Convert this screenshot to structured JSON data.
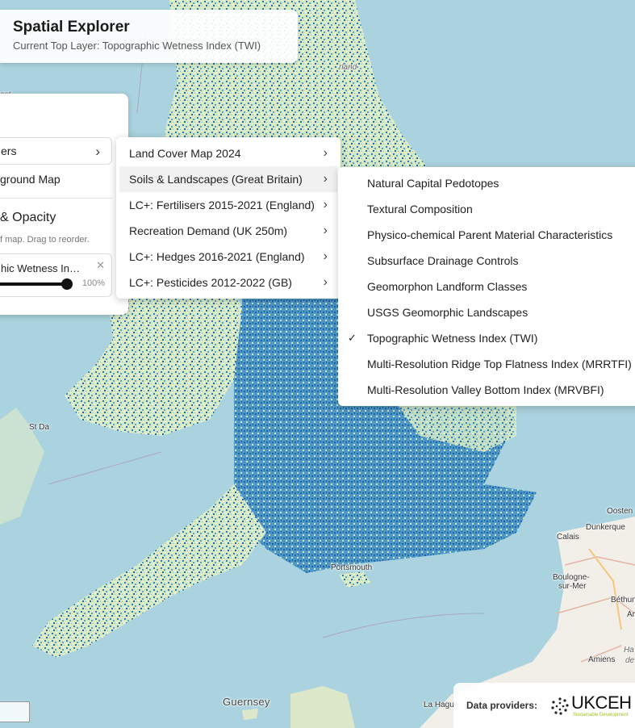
{
  "header": {
    "title": "Spatial Explorer",
    "subtitle": "Current Top Layer: Topographic Wetness Index (TWI)"
  },
  "panel": {
    "layers_label": "ers",
    "background_label": "ground Map",
    "opacity_title": "& Opacity",
    "opacity_hint": "f map. Drag to reorder.",
    "layer_name": "hic Wetness In…",
    "layer_opacity_value": 1.0,
    "layer_opacity_label": "100%"
  },
  "menu_categories": [
    {
      "label": "Land Cover Map 2024"
    },
    {
      "label": "Soils & Landscapes (Great Britain)"
    },
    {
      "label": "LC+: Fertilisers 2015-2021 (England)"
    },
    {
      "label": "Recreation Demand (UK 250m)"
    },
    {
      "label": "LC+: Hedges 2016-2021 (England)"
    },
    {
      "label": "LC+: Pesticides 2012-2022 (GB)"
    }
  ],
  "active_category": "Soils & Landscapes (Great Britain)",
  "menu_layers": [
    {
      "label": "Natural Capital Pedotopes",
      "checked": false
    },
    {
      "label": "Textural Composition",
      "checked": false
    },
    {
      "label": "Physico-chemical Parent Material Characteristics",
      "checked": false
    },
    {
      "label": "Subsurface Drainage Controls",
      "checked": false
    },
    {
      "label": "Geomorphon Landform Classes",
      "checked": false
    },
    {
      "label": "USGS Geomorphic Landscapes",
      "checked": false
    },
    {
      "label": "Topographic Wetness Index (TWI)",
      "checked": true
    },
    {
      "label": "Multi-Resolution Ridge Top Flatness Index (MRRTFI)",
      "checked": false
    },
    {
      "label": "Multi-Resolution Valley Bottom Index (MRVBFI)",
      "checked": false
    }
  ],
  "map_labels": {
    "rland": "rland",
    "stdavids": "St Da",
    "portsmouth": "Portsmouth",
    "guernsey": "Guernsey",
    "calais": "Calais",
    "dunkerque": "Dunkerque",
    "oostende": "Oosten",
    "boulogne1": "Boulogne-",
    "boulogne2": "sur-Mer",
    "bethune": "Béthun",
    "amiens": "Amiens",
    "herve": "La Hague",
    "hauts": "Ha",
    "de": "de",
    "ar": "Ar",
    "ast": "ast"
  },
  "footer": {
    "providers_label": "Data providers:",
    "logo_text": "UKCEH",
    "logo_tagline": "Sustainable Development"
  },
  "colors": {
    "sea": "#aad3df",
    "land_base": "#9fd2c0",
    "raster_light": "#e8f3c7",
    "raster_dark": "#1f76b4",
    "france_land": "#f2efe9",
    "accent_logo": "#9cc21f"
  },
  "icons": {
    "chevron": "chevron-right-icon",
    "check": "check-icon",
    "close": "close-icon"
  }
}
